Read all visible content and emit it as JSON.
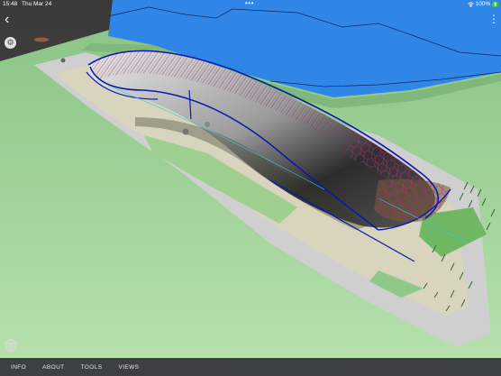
{
  "status_bar": {
    "time": "15:48",
    "date": "Thu Mar 24",
    "multitask_dots": "•••",
    "battery_text": "100%",
    "battery_icon": "battery-full-icon",
    "wifi_icon": "wifi-icon"
  },
  "toolbar": {
    "back_icon": "chevron-left-icon",
    "settings_icon": "gear-icon",
    "more_icon": "more-vertical-icon",
    "back_glyph": "‹",
    "settings_glyph": "⚙",
    "more_glyph": "⋮"
  },
  "viewer": {
    "navigation_cube_icon": "view-cube-icon"
  },
  "bottom_tabs": [
    "INFO",
    "ABOUT",
    "TOOLS",
    "VIEWS"
  ],
  "colors": {
    "water": "#2f86e6",
    "land": "#8fc98a",
    "plaza": "#d6d2ba",
    "paving": "#cfcfcf",
    "structure_outline": "#0b1aa8",
    "lattice": "#a0307a",
    "bottom_bar": "#3c3f44",
    "battery": "#3fbf4a"
  }
}
